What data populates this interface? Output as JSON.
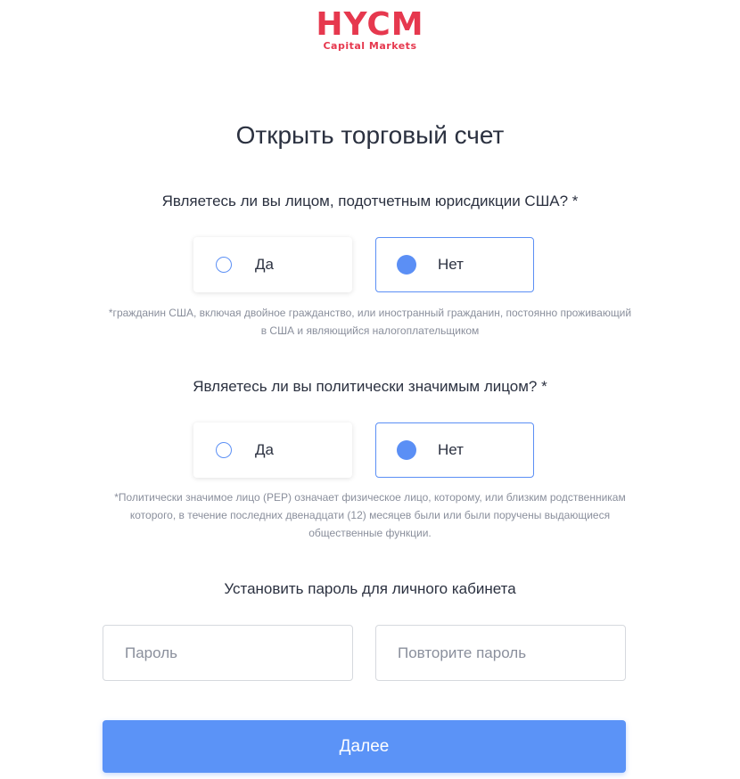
{
  "brand": {
    "name": "HYCM",
    "tagline": "Capital Markets",
    "color": "#e6384e"
  },
  "page_title": "Открыть торговый счет",
  "us_question": {
    "label": "Являетесь ли вы лицом, подотчетным юрисдикции США? *",
    "options": [
      {
        "label": "Да",
        "selected": false
      },
      {
        "label": "Нет",
        "selected": true
      }
    ],
    "note_line1": "*гражданин США, включая двойное гражданство, или иностранный гражданин, постоянно проживающий",
    "note_line2": "в США и являющийся налогоплательщиком"
  },
  "pep_question": {
    "label": "Являетесь ли вы политически значимым лицом? *",
    "options": [
      {
        "label": "Да",
        "selected": false
      },
      {
        "label": "Нет",
        "selected": true
      }
    ],
    "note_line1": "*Политически значимое лицо (PEP) означает физическое лицо, которому, или близким родственникам",
    "note_line2": "которого, в течение последних двенадцати (12) месяцев были или были поручены выдающиеся",
    "note_line3": "общественные функции."
  },
  "password_section": {
    "label": "Установить пароль для личного кабинета",
    "password_placeholder": "Пароль",
    "repeat_placeholder": "Повторите пароль",
    "password_value": "",
    "repeat_value": ""
  },
  "submit_label": "Далее",
  "colors": {
    "accent": "#5b93f7",
    "text": "#2b3140",
    "muted": "#8a8f9c"
  }
}
